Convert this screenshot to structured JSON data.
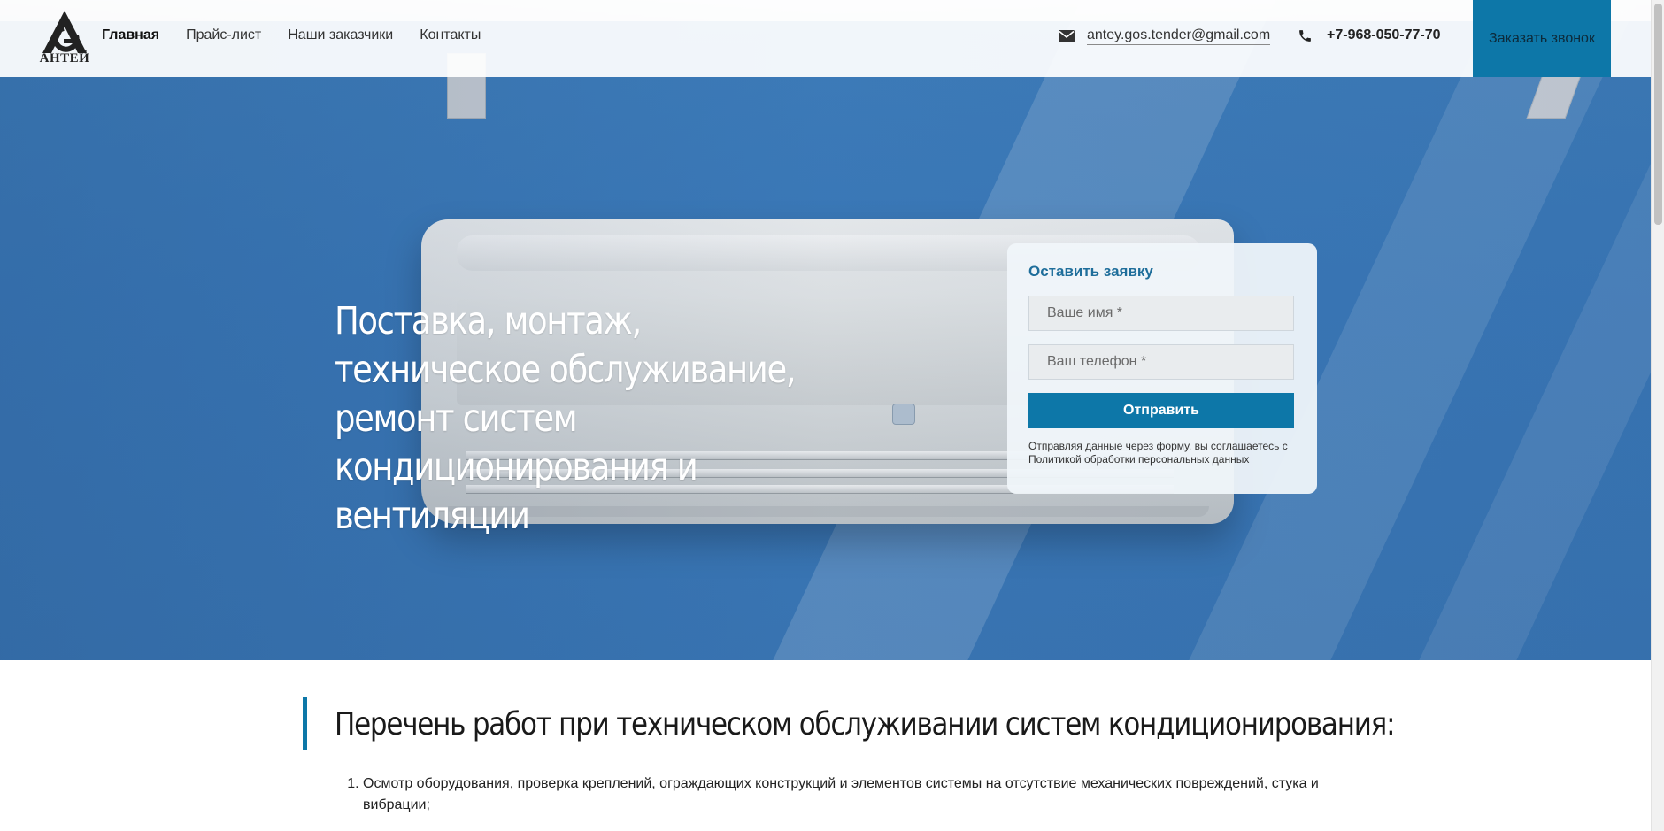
{
  "brand": {
    "logo_text": "АНТЕЙ"
  },
  "nav": {
    "items": [
      {
        "label": "Главная",
        "active": true
      },
      {
        "label": "Прайс-лист",
        "active": false
      },
      {
        "label": "Наши заказчики",
        "active": false
      },
      {
        "label": "Контакты",
        "active": false
      }
    ]
  },
  "contacts": {
    "email": "antey.gos.tender@gmail.com",
    "phone": "+7-968-050-77-70",
    "callback_label": "Заказать звонок"
  },
  "hero": {
    "title": "Поставка, монтаж, техническое обслуживание, ремонт систем кондиционирования и вентиляции"
  },
  "form": {
    "title": "Оставить заявку",
    "name_placeholder": "Ваше имя *",
    "phone_placeholder": "Ваш телефон *",
    "submit_label": "Отправить",
    "consent_text": "Отправляя данные через форму, вы соглашаетесь с",
    "consent_link": "Политикой обработки персональных данных"
  },
  "section": {
    "title": "Перечень работ при техническом обслуживании систем кондиционирования:",
    "items": [
      "Осмотр оборудования, проверка креплений, ограждающих конструкций и элементов системы на отсутствие механических повреждений, стука и вибрации;"
    ]
  },
  "colors": {
    "accent": "#0d77a8",
    "hero_blue": "#3b7abb",
    "form_title": "#1f6e9b"
  }
}
